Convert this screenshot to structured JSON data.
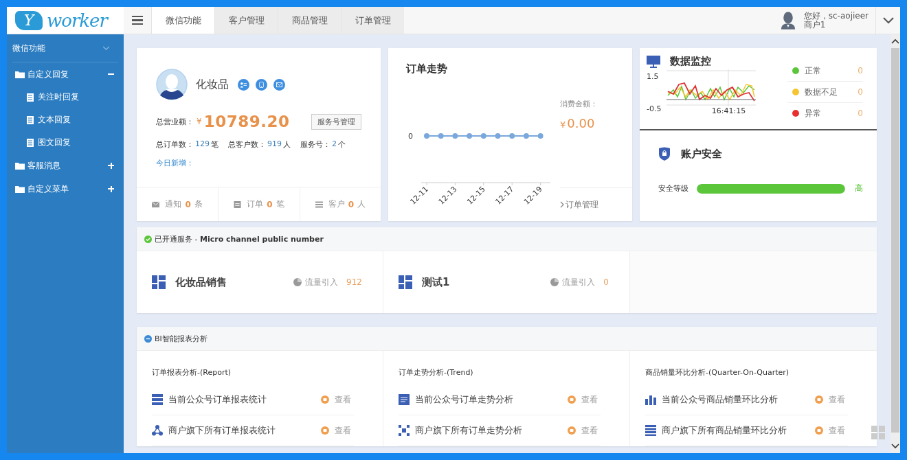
{
  "header": {
    "logo": {
      "letter": "Y",
      "word": "worker"
    },
    "nav": [
      {
        "label": "微信功能",
        "selected": true
      },
      {
        "label": "客户管理",
        "selected": false
      },
      {
        "label": "商品管理",
        "selected": false
      },
      {
        "label": "订单管理",
        "selected": false
      }
    ],
    "user": {
      "greeting": "您好，sc-aojieer",
      "role": "商户1"
    }
  },
  "sidebar": {
    "title": "微信功能",
    "items": [
      {
        "label": "自定义回复",
        "expanded": true,
        "children": [
          {
            "label": "关注时回复"
          },
          {
            "label": "文本回复"
          },
          {
            "label": "图文回复"
          }
        ]
      },
      {
        "label": "客服消息",
        "expanded": false
      },
      {
        "label": "自定义菜单",
        "expanded": false
      }
    ]
  },
  "profile": {
    "name": "化妆品",
    "revenue_label": "总营业额：",
    "currency": "¥",
    "revenue": "10789.20",
    "button": "服务号管理",
    "stats": [
      {
        "label": "总订单数：",
        "value": "129",
        "unit": "笔"
      },
      {
        "label": "总客户数：",
        "value": "919",
        "unit": "人"
      },
      {
        "label": "服务号：",
        "value": "2",
        "unit": "个"
      }
    ],
    "today_label": "今日新增：",
    "footer": [
      {
        "kind": "mail",
        "label": "通知",
        "count": "0",
        "unit": "条"
      },
      {
        "kind": "order",
        "label": "订单",
        "count": "0",
        "unit": "笔"
      },
      {
        "kind": "list",
        "label": "客户",
        "count": "0",
        "unit": "人"
      }
    ]
  },
  "order_trend": {
    "title": "订单走势",
    "spend_label": "消费金额：",
    "currency": "¥",
    "spend": "0.00",
    "link": "订单管理",
    "axis": {
      "y_tick": "0",
      "x_labels": [
        "12-11",
        "12-13",
        "12-15",
        "12-17",
        "12-19"
      ]
    }
  },
  "monitor": {
    "title": "数据监控",
    "axis_labels": [
      "1.5",
      "-0.5"
    ],
    "time": "16:41:15",
    "legend": [
      {
        "label": "正常",
        "count": "0",
        "color": "#5cc63a"
      },
      {
        "label": "数据不足",
        "count": "0",
        "color": "#f5c531"
      },
      {
        "label": "异常",
        "count": "0",
        "color": "#e8312f"
      }
    ]
  },
  "security": {
    "title": "账户安全",
    "label": "安全等级",
    "level": 1.0,
    "reading": "高"
  },
  "services": {
    "title": "已开通服务 - **Micro channel public number**",
    "items": [
      {
        "name": "化妆品销售",
        "metric_label": "流量引入",
        "metric_value": "912"
      },
      {
        "name": "测试1",
        "metric_label": "流量引入",
        "metric_value": "0"
      }
    ]
  },
  "bi": {
    "title": "BI智能报表分析",
    "columns": [
      {
        "title": "订单报表分析-(Report)",
        "rows": [
          {
            "kind": "server",
            "label": "当前公众号订单报表统计",
            "action": "查看"
          },
          {
            "kind": "share",
            "label": "商户旗下所有订单报表统计",
            "action": "查看"
          }
        ]
      },
      {
        "title": "订单走势分析-(Trend)",
        "rows": [
          {
            "kind": "doc",
            "label": "当前公众号订单走势分析",
            "action": "查看"
          },
          {
            "kind": "scan",
            "label": "商户旗下所有订单走势分析",
            "action": "查看"
          }
        ]
      },
      {
        "title": "商品销量环比分析-(Quarter-On-Quarter)",
        "rows": [
          {
            "kind": "bars",
            "label": "当前公众号商品销量环比分析",
            "action": "查看"
          },
          {
            "kind": "lines",
            "label": "商户旗下所有商品销量环比分析",
            "action": "查看"
          }
        ]
      }
    ]
  }
}
